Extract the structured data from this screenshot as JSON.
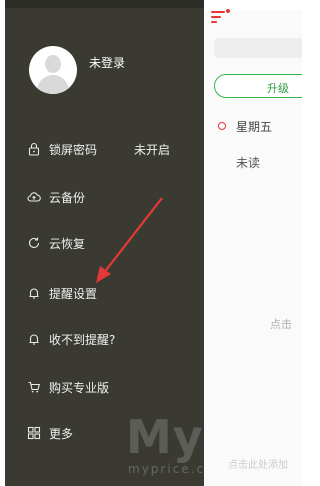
{
  "drawer": {
    "user": {
      "status": "未登录"
    },
    "items": [
      {
        "label": "锁屏密码",
        "value": "未开启",
        "icon": "lock-icon"
      },
      {
        "label": "云备份",
        "icon": "cloud-upload-icon"
      },
      {
        "label": "云恢复",
        "icon": "restore-icon"
      },
      {
        "label": "提醒设置",
        "icon": "bell-icon"
      },
      {
        "label": "收不到提醒?",
        "icon": "bell-question-icon"
      },
      {
        "label": "购买专业版",
        "icon": "cart-icon"
      },
      {
        "label": "更多",
        "icon": "grid-icon"
      }
    ]
  },
  "main": {
    "upgrade_label": "升级",
    "day_label": "星期五",
    "unread_label": "未读",
    "hint": "点击",
    "hint2": "点击此处添加"
  },
  "watermark": {
    "brand": "MyPrice",
    "sub": "myprice.com"
  },
  "colors": {
    "drawer_bg": "#3a3a33",
    "accent": "#e53935",
    "upgrade": "#39b54a"
  }
}
